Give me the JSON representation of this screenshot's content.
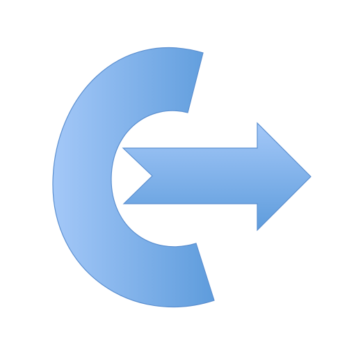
{
  "icon": {
    "name": "exit-arrow-icon",
    "colors": {
      "background": "#ffffff",
      "fill_light": "#a4c8f8",
      "fill_dark": "#5e9cdc",
      "stroke": "#5b8fd0"
    }
  }
}
